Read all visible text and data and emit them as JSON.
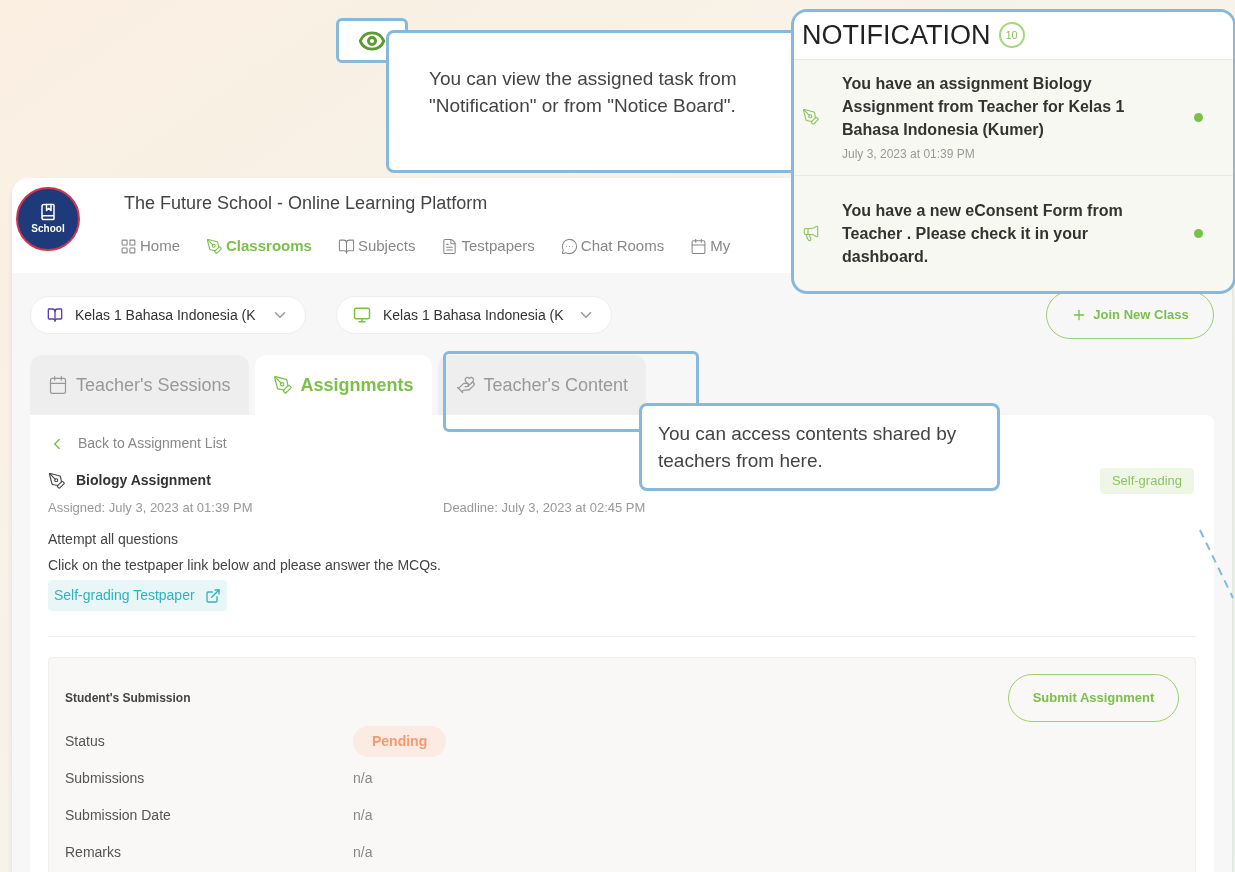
{
  "callouts": [
    {
      "text": "You can view the assigned task from \"Notification\" or from \"Notice Board\"."
    },
    {
      "text": "You can access contents shared by teachers from here."
    }
  ],
  "notification": {
    "title": "NOTIFICATION",
    "count": "10",
    "items": [
      {
        "kind": "assignment",
        "text": "You have an assignment Biology Assignment from Teacher for Kelas 1 Bahasa Indonesia (Kumer)",
        "time": "July 3, 2023 at 01:39 PM",
        "unread": true
      },
      {
        "kind": "announcement",
        "text": "You have a new eConsent Form from Teacher . Please check it in your dashboard.",
        "unread": true
      }
    ]
  },
  "app": {
    "title": "The Future School - Online Learning Platform",
    "logo_text": "School",
    "nav": [
      {
        "label": "Home",
        "selected": false
      },
      {
        "label": "Classrooms",
        "selected": true
      },
      {
        "label": "Subjects",
        "selected": false
      },
      {
        "label": "Testpapers",
        "selected": false
      },
      {
        "label": "Chat Rooms",
        "selected": false
      },
      {
        "label": "My",
        "selected": false
      }
    ],
    "selectors": [
      {
        "text": "Kelas 1 Bahasa Indonesia (K"
      },
      {
        "text": "Kelas 1 Bahasa Indonesia (K"
      }
    ],
    "join_button": "Join New Class",
    "tabs": [
      {
        "label": "Teacher's Sessions",
        "selected": false,
        "highlighted": false
      },
      {
        "label": "Assignments",
        "selected": true,
        "highlighted": false
      },
      {
        "label": "Teacher's Content",
        "selected": false,
        "highlighted": true
      }
    ],
    "back_link": "Back to Assignment List",
    "assignment": {
      "title": "Biology Assignment",
      "tag": "Self-grading",
      "assigned": "Assigned: July 3, 2023 at 01:39 PM",
      "deadline": "Deadline: July 3, 2023 at 02:45 PM",
      "lines": [
        "Attempt all questions",
        "Click on the testpaper link below and please answer the MCQs."
      ],
      "link": "Self-grading Testpaper"
    },
    "submission": {
      "title": "Student's Submission",
      "button": "Submit Assignment",
      "rows": [
        {
          "label": "Status",
          "value": "Pending",
          "kind": "pill"
        },
        {
          "label": "Submissions",
          "value": "n/a",
          "kind": "text"
        },
        {
          "label": "Submission Date",
          "value": "n/a",
          "kind": "text"
        },
        {
          "label": "Remarks",
          "value": "n/a",
          "kind": "text"
        }
      ]
    }
  }
}
